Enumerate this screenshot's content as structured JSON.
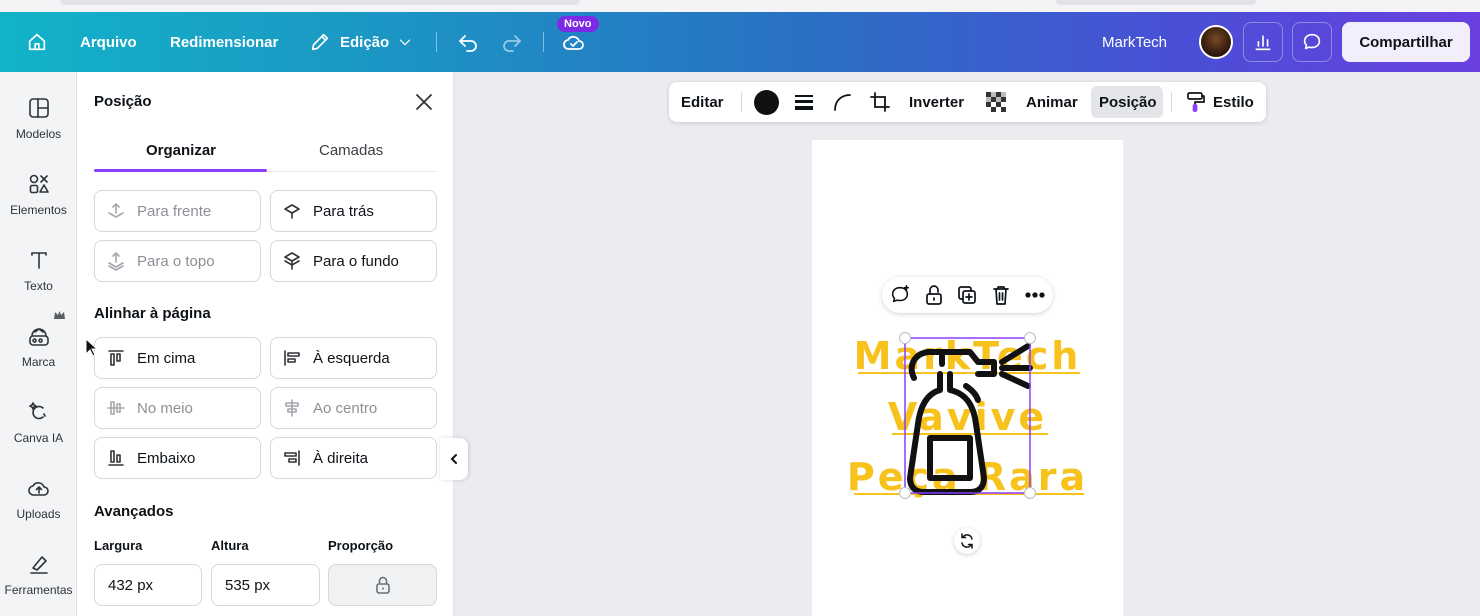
{
  "topbar": {
    "menu_file": "Arquivo",
    "menu_resize": "Redimensionar",
    "menu_edit": "Edição",
    "badge_new": "Novo",
    "brand_name": "MarkTech",
    "share_label": "Compartilhar",
    "gradient_colors": [
      "#12b3c9",
      "#2a6fc4",
      "#6a3fe0"
    ]
  },
  "sidebar": {
    "items": [
      {
        "label": "Modelos",
        "icon": "templates-icon"
      },
      {
        "label": "Elementos",
        "icon": "elements-icon"
      },
      {
        "label": "Texto",
        "icon": "text-icon"
      },
      {
        "label": "Marca",
        "icon": "brand-icon"
      },
      {
        "label": "Canva IA",
        "icon": "magic-icon"
      },
      {
        "label": "Uploads",
        "icon": "upload-cloud-icon"
      },
      {
        "label": "Ferramentas",
        "icon": "draw-tools-icon"
      }
    ]
  },
  "panel": {
    "title": "Posição",
    "tabs": [
      {
        "label": "Organizar",
        "active": true
      },
      {
        "label": "Camadas",
        "active": false
      }
    ],
    "arrange": [
      {
        "label": "Para frente",
        "enabled": false
      },
      {
        "label": "Para trás",
        "enabled": true
      },
      {
        "label": "Para o topo",
        "enabled": false
      },
      {
        "label": "Para o fundo",
        "enabled": true
      }
    ],
    "align_heading": "Alinhar à página",
    "align": [
      {
        "label": "Em cima",
        "enabled": true
      },
      {
        "label": "À esquerda",
        "enabled": true
      },
      {
        "label": "No meio",
        "enabled": false
      },
      {
        "label": "Ao centro",
        "enabled": false
      },
      {
        "label": "Embaixo",
        "enabled": true
      },
      {
        "label": "À direita",
        "enabled": true
      }
    ],
    "advanced_heading": "Avançados",
    "width_label": "Largura",
    "width_value": "432 px",
    "height_label": "Altura",
    "height_value": "535 px",
    "ratio_label": "Proporção"
  },
  "context_toolbar": {
    "edit": "Editar",
    "flip": "Inverter",
    "animate": "Animar",
    "position": "Posição",
    "style": "Estilo",
    "fill_color": "#111111"
  },
  "design": {
    "line1": "MarkTech",
    "line2": "Vavive",
    "line3": "Peça Rara",
    "text_color": "#f6c21b",
    "accent_color": "#8b3dff"
  }
}
